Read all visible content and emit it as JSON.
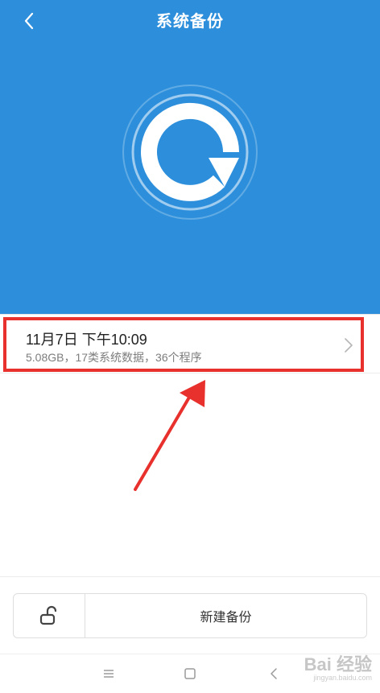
{
  "header": {
    "title": "系统备份",
    "background_color": "#2d8fdb"
  },
  "backup_list": {
    "items": [
      {
        "title": "11月7日 下午10:09",
        "subtitle": "5.08GB，17类系统数据，36个程序"
      }
    ],
    "highlight_color": "#e8312d"
  },
  "bottom_bar": {
    "lock_icon": "unlock-icon",
    "new_backup_label": "新建备份"
  },
  "navbar": {
    "icons": [
      "menu-icon",
      "home-icon",
      "back-icon"
    ]
  },
  "watermark": {
    "text": "Bai 经验",
    "sub": "jingyan.baidu.com"
  }
}
